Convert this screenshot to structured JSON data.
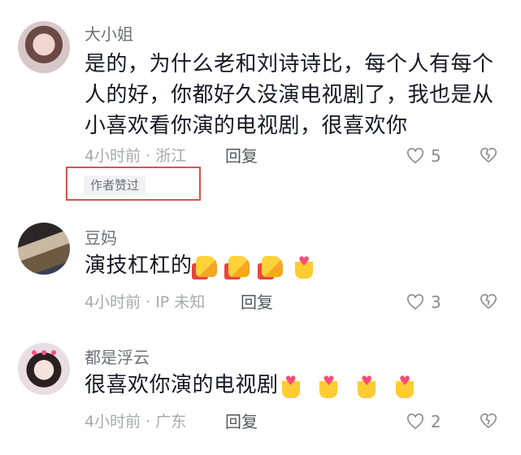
{
  "comments": [
    {
      "username": "大小姐",
      "text": "是的，为什么老和刘诗诗比，每个人有每个人的好，你都好久没演电视剧了，我也是从小喜欢看你演的电视剧，很喜欢你",
      "meta": "4小时前 · 浙江",
      "reply_label": "回复",
      "like_count": "5",
      "author_liked": "作者赞过"
    },
    {
      "username": "豆妈",
      "text": "演技杠杠的",
      "emojis": [
        "thumbs-up",
        "thumbs-up",
        "thumbs-up",
        "finger-heart"
      ],
      "meta": "4小时前 · IP 未知",
      "reply_label": "回复",
      "like_count": "3"
    },
    {
      "username": "都是浮云",
      "text": "很喜欢你演的电视剧",
      "emojis": [
        "finger-heart",
        "finger-heart",
        "finger-heart",
        "finger-heart"
      ],
      "meta": "4小时前 · 广东",
      "reply_label": "回复",
      "like_count": "2"
    }
  ],
  "colors": {
    "highlight_box": "#d9534f",
    "username": "#6e7077",
    "meta": "#a7a8ac"
  }
}
